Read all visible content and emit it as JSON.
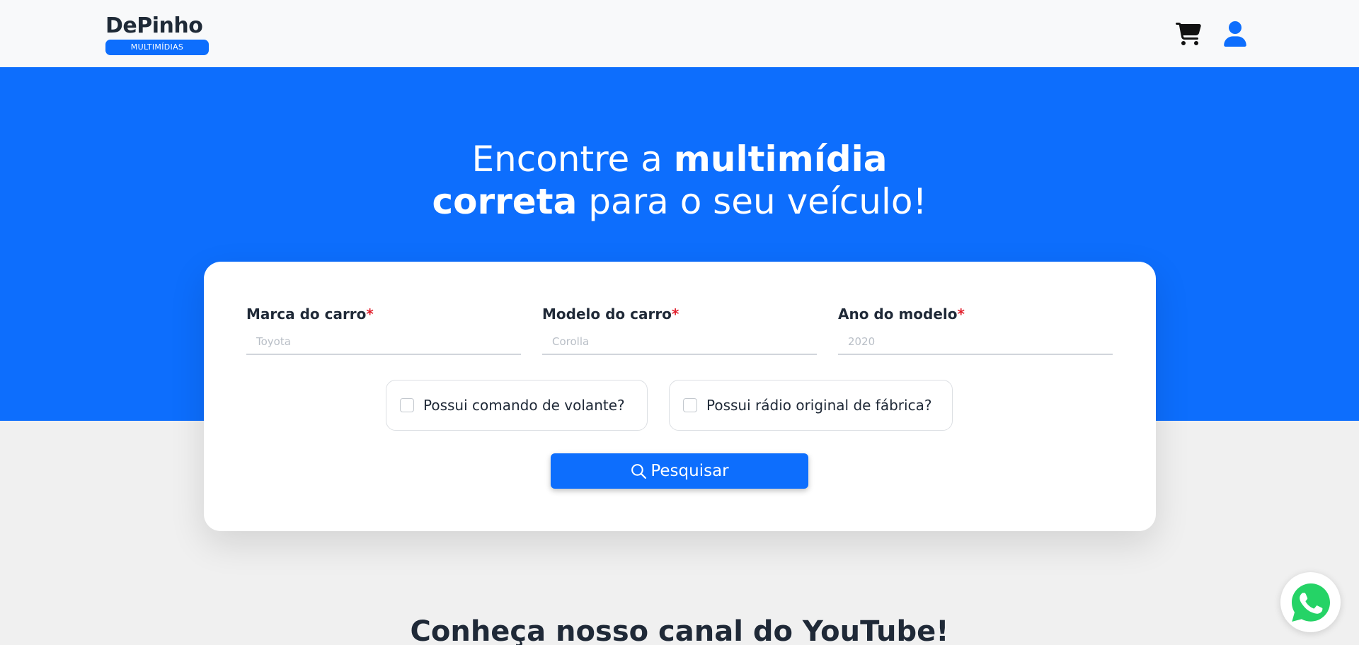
{
  "header": {
    "logo_title": "DePinho",
    "logo_subtitle": "MULTIMÍDIAS",
    "icons": [
      "cart-icon",
      "user-icon"
    ]
  },
  "hero": {
    "title_line1_regular": "Encontre a ",
    "title_line1_bold": "multimídia",
    "title_line2_bold": "correta",
    "title_line2_regular": " para o seu veículo!"
  },
  "form": {
    "fields": [
      {
        "label": "Marca do carro",
        "required_mark": "*",
        "placeholder": "Toyota",
        "value": ""
      },
      {
        "label": "Modelo do carro",
        "required_mark": "*",
        "placeholder": "Corolla",
        "value": ""
      },
      {
        "label": "Ano do modelo",
        "required_mark": "*",
        "placeholder": "2020",
        "value": ""
      }
    ],
    "checkboxes": [
      {
        "label": "Possui comando de volante?",
        "checked": false
      },
      {
        "label": "Possui rádio original de fábrica?",
        "checked": false
      }
    ],
    "search_button": "Pesquisar"
  },
  "youtube_title": "Conheça nosso canal do YouTube!",
  "colors": {
    "primary": "#0d6efd",
    "required": "#e11d2a",
    "whatsapp": "#25d366",
    "dark_text": "#1f2937"
  }
}
